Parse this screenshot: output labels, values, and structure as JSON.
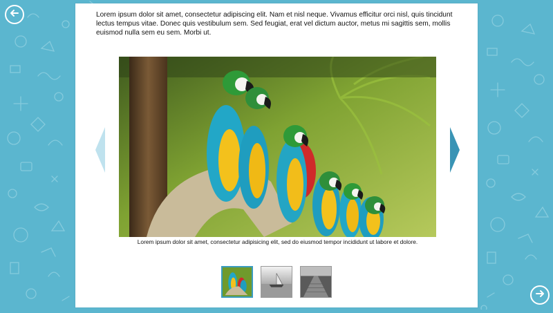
{
  "lesson": {
    "intro_text": "Lorem ipsum dolor sit amet, consectetur adipiscing elit. Nam et nisl neque. Vivamus efficitur orci nisl, quis tincidunt lectus tempus vitae. Donec quis vestibulum sem. Sed feugiat, erat vel dictum auctor, metus mi sagittis sem, mollis euismod nulla sem eu sem. Morbi ut.",
    "caption": "Lorem ipsum dolor sit amet, consectetur adipisicing elit, sed do eiusmod tempor incididunt ut labore et dolore."
  },
  "gallery": {
    "main_image": "macaws-on-branch-photo",
    "thumbnails": [
      {
        "image": "macaws-thumbnail",
        "selected": true
      },
      {
        "image": "boat-on-water-thumbnail",
        "selected": false
      },
      {
        "image": "pier-boardwalk-thumbnail",
        "selected": false
      }
    ]
  },
  "icons": {
    "back": "arrow-left-circle-icon",
    "forward": "arrow-right-circle-icon",
    "prev": "triangle-left-icon",
    "next": "triangle-right-icon"
  },
  "colors": {
    "background": "#5bb6cf",
    "accent": "#3a9cbf",
    "prev_arrow": "#bfe2ee",
    "next_arrow": "#3a94b5"
  }
}
